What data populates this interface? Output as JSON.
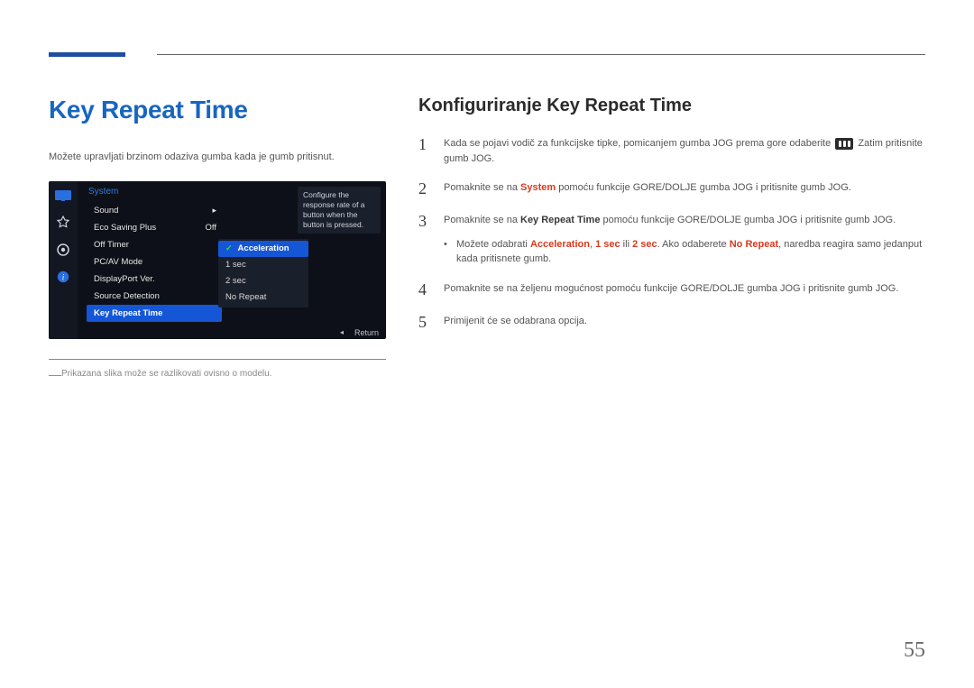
{
  "page_number": "55",
  "title": "Key Repeat Time",
  "intro": "Možete upravljati brzinom odaziva gumba kada je gumb pritisnut.",
  "osd": {
    "section": "System",
    "items": [
      {
        "label": "Sound",
        "value": "",
        "arrow": true
      },
      {
        "label": "Eco Saving Plus",
        "value": "Off"
      },
      {
        "label": "Off Timer",
        "value": ""
      },
      {
        "label": "PC/AV Mode",
        "value": ""
      },
      {
        "label": "DisplayPort Ver.",
        "value": ""
      },
      {
        "label": "Source Detection",
        "value": ""
      },
      {
        "label": "Key Repeat Time",
        "value": "",
        "selected": true
      }
    ],
    "submenu": [
      {
        "label": "Acceleration",
        "selected": true
      },
      {
        "label": "1 sec"
      },
      {
        "label": "2 sec"
      },
      {
        "label": "No Repeat"
      }
    ],
    "tooltip": "Configure the response rate of a button when the button is pressed.",
    "footer_return": "Return"
  },
  "footnote": "Prikazana slika može se razlikovati ovisno o modelu.",
  "subtitle": "Konfiguriranje Key Repeat Time",
  "steps": {
    "s1_a": "Kada se pojavi vodič za funkcijske tipke, pomicanjem gumba JOG prema gore odaberite",
    "s1_b": "Zatim pritisnite gumb JOG.",
    "s2_a": "Pomaknite se na ",
    "s2_sys": "System",
    "s2_b": " pomoću funkcije GORE/DOLJE gumba JOG i pritisnite gumb JOG.",
    "s3_a": "Pomaknite se na ",
    "s3_k": "Key Repeat Time",
    "s3_b": " pomoću funkcije GORE/DOLJE gumba JOG i pritisnite gumb JOG.",
    "s3_bullet_a": "Možete odabrati ",
    "s3_acc": "Acceleration",
    "s3_comma1": ", ",
    "s3_1s": "1 sec",
    "s3_or": " ili ",
    "s3_2s": "2 sec",
    "s3_dot": ". Ako odaberete ",
    "s3_nr": "No Repeat",
    "s3_tail": ", naredba reagira samo jedanput kada pritisnete gumb.",
    "s4": "Pomaknite se na željenu mogućnost pomoću funkcije GORE/DOLJE gumba JOG i pritisnite gumb JOG.",
    "s5": "Primijenit će se odabrana opcija."
  }
}
